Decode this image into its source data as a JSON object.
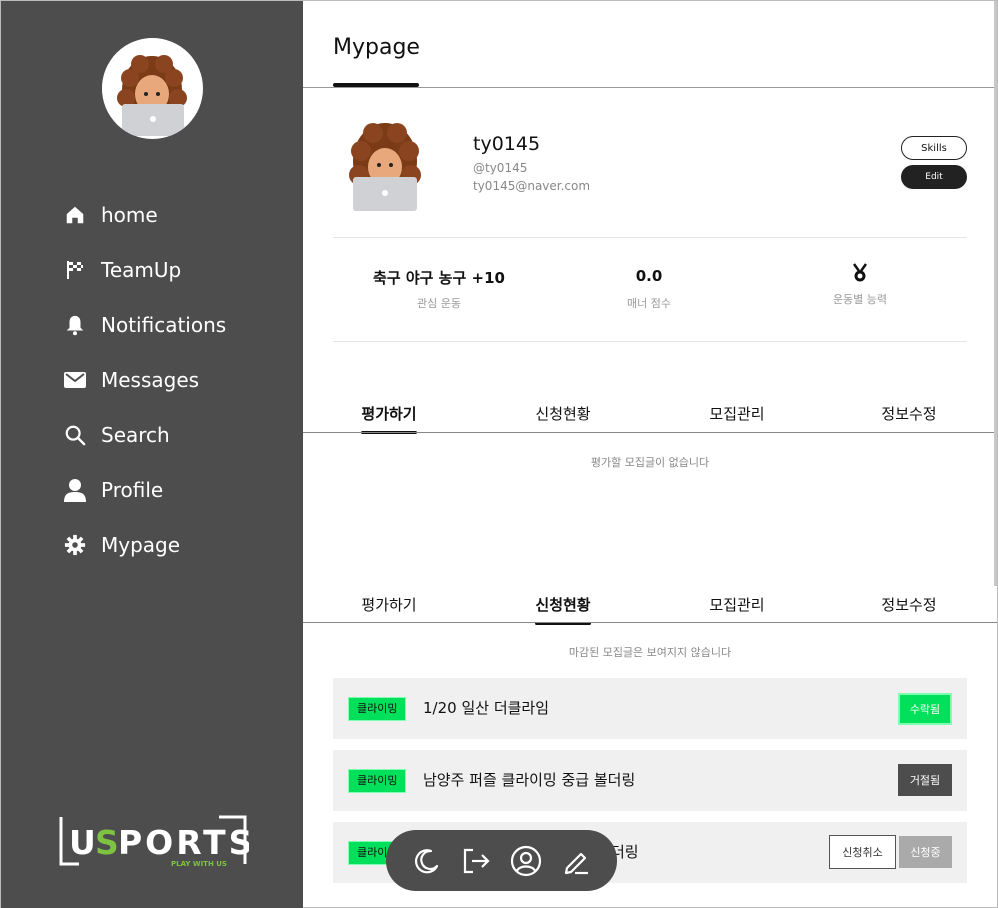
{
  "sidebar": {
    "items": [
      {
        "label": "home",
        "icon": "home-icon"
      },
      {
        "label": "TeamUp",
        "icon": "checkered-flag-icon"
      },
      {
        "label": "Notifications",
        "icon": "bell-icon"
      },
      {
        "label": "Messages",
        "icon": "envelope-icon"
      },
      {
        "label": "Search",
        "icon": "search-icon"
      },
      {
        "label": "Profile",
        "icon": "user-icon"
      },
      {
        "label": "Mypage",
        "icon": "gear-icon"
      }
    ],
    "logo": {
      "main": "USPORTS",
      "tagline": "PLAY WITH US"
    }
  },
  "page": {
    "title": "Mypage"
  },
  "profile": {
    "username": "ty0145",
    "handle": "@ty0145",
    "email": "ty0145@naver.com",
    "skills_label": "Skills",
    "edit_label": "Edit"
  },
  "stats": [
    {
      "value": "축구 야구 농구 +10",
      "caption": "관심 운동"
    },
    {
      "value": "0.0",
      "caption": "매너 점수"
    },
    {
      "value": "",
      "icon": "medal-icon",
      "caption": "운동별 능력"
    }
  ],
  "tabs": [
    "평가하기",
    "신청현황",
    "모집관리",
    "정보수정"
  ],
  "section1": {
    "active_tab": 0,
    "note": "평가할 모집글이 없습니다"
  },
  "section2": {
    "active_tab": 1,
    "note": "마감된 모집글은 보여지지 않습니다",
    "rows": [
      {
        "tag": "클라이밍",
        "title": "1/20 일산 더클라임",
        "status": "수락됨"
      },
      {
        "tag": "클라이밍",
        "title": "남양주 퍼즐 클라이밍 중급 볼더링",
        "status": "거절됨"
      },
      {
        "tag": "클라이밍",
        "title": "더링",
        "cancel": "신청취소",
        "status": "신청중"
      }
    ]
  },
  "colors": {
    "sidebar": "#4d4d4d",
    "accent": "#00e05a",
    "logo_accent": "#7ec242"
  },
  "floating_bar": {
    "icons": [
      "moon-icon",
      "logout-icon",
      "user-circle-icon",
      "pencil-icon"
    ]
  }
}
